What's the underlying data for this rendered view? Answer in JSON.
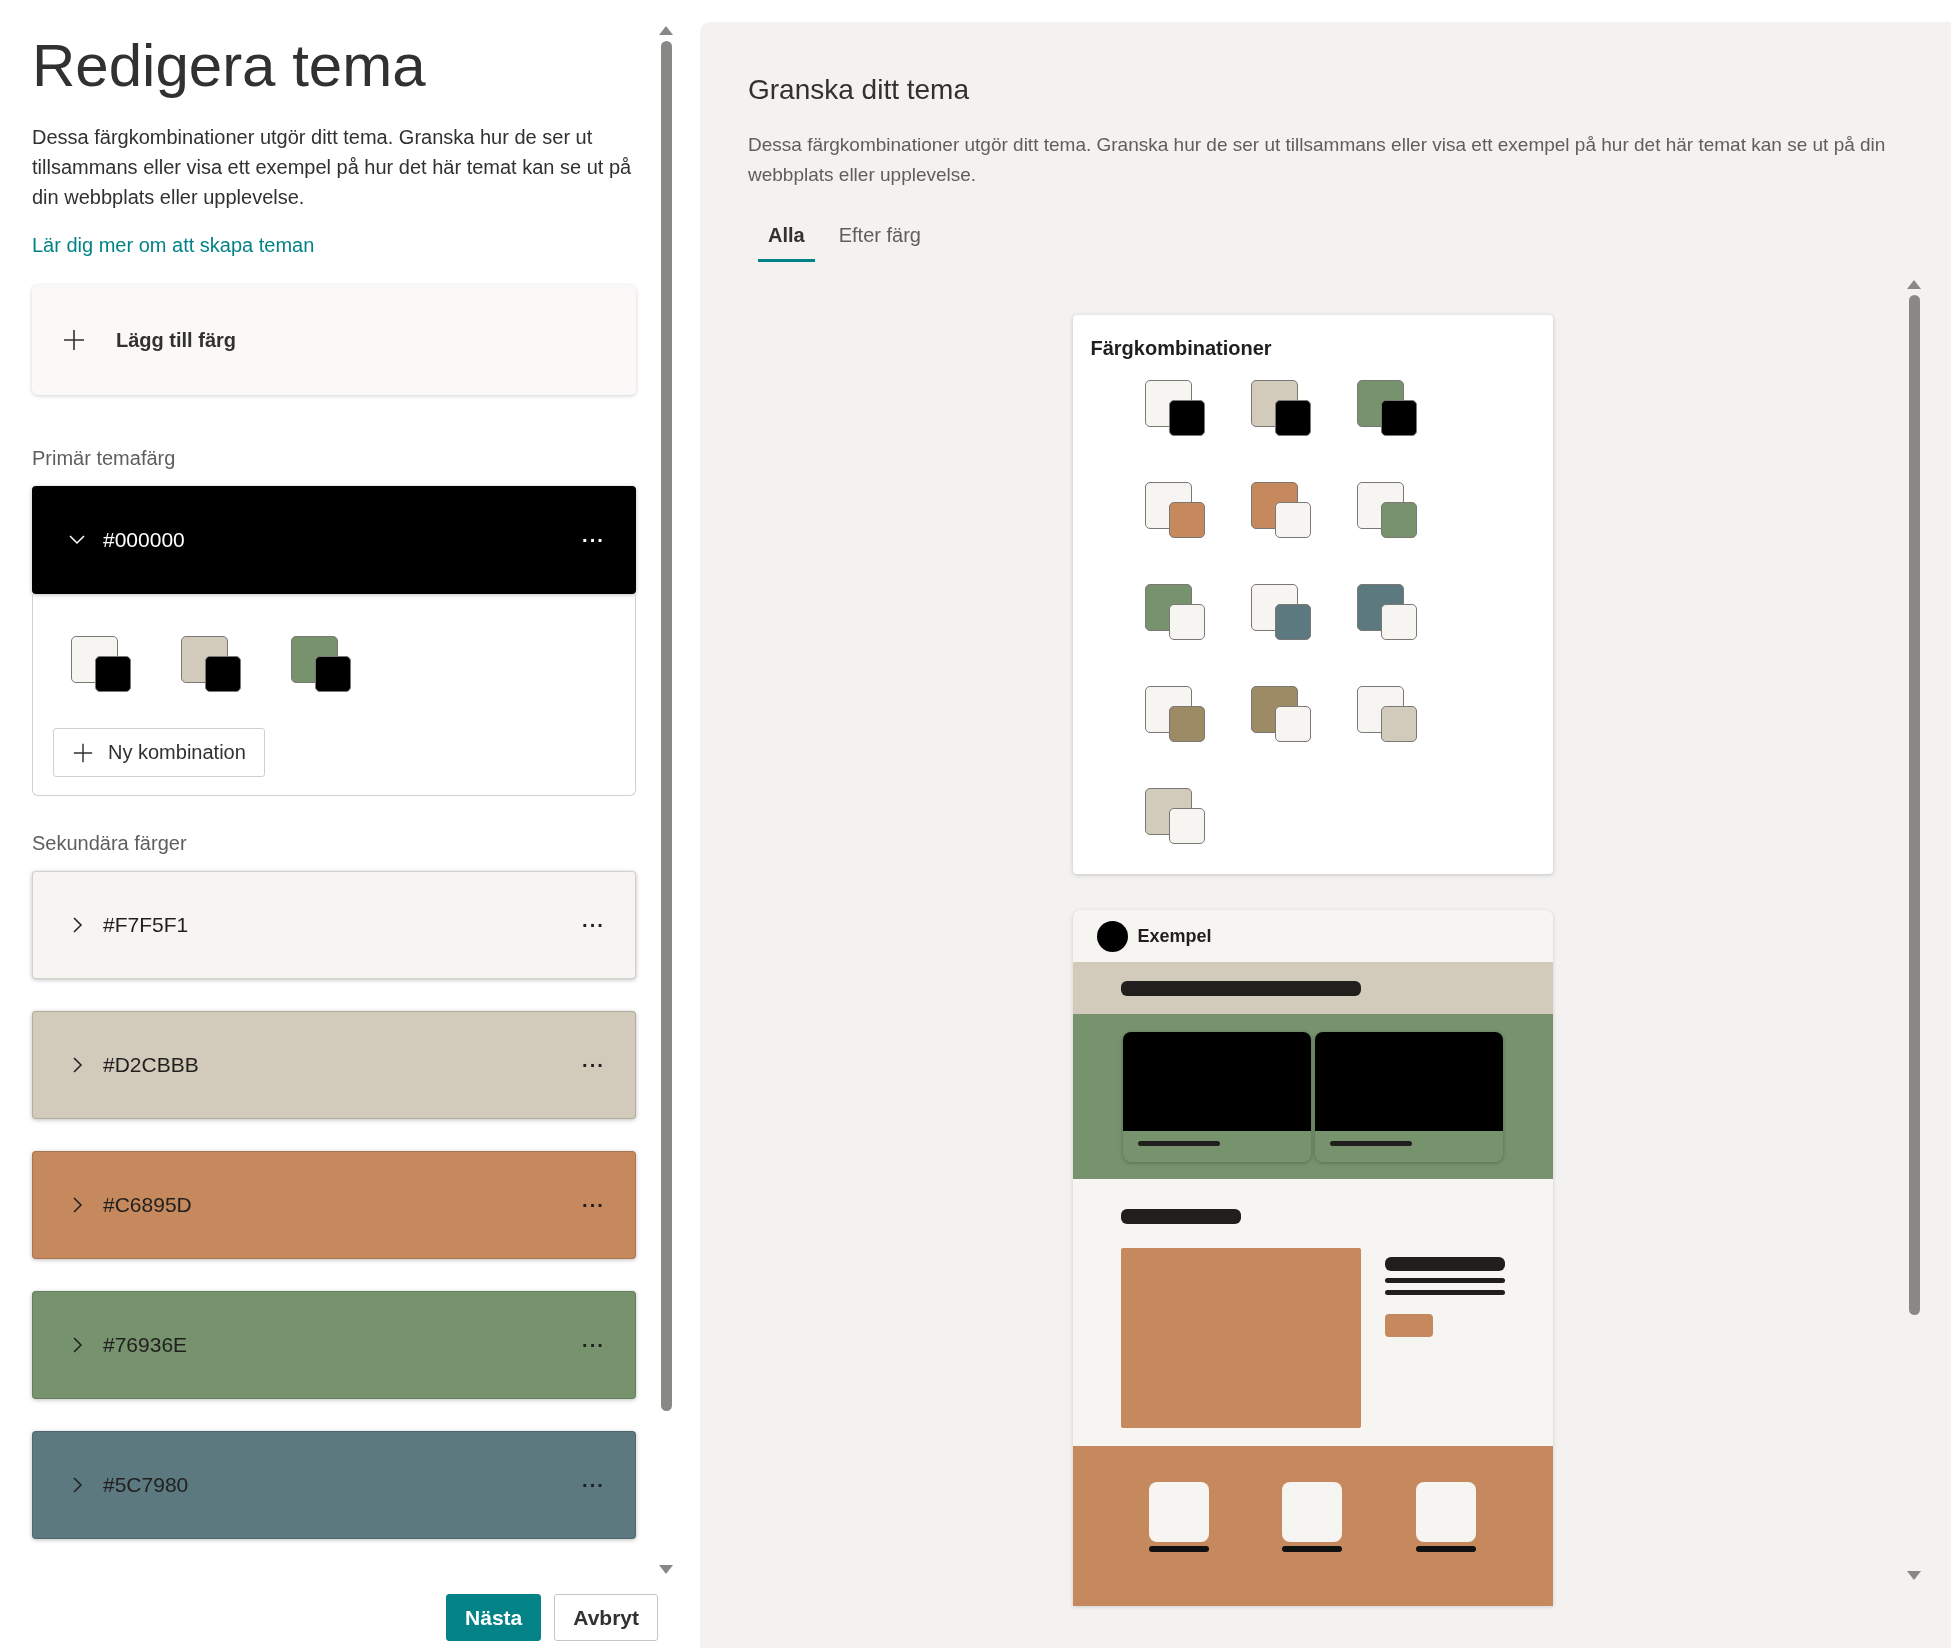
{
  "editor": {
    "title": "Redigera tema",
    "description": "Dessa färgkombinationer utgör ditt tema. Granska hur de ser ut tillsammans eller visa ett exempel på hur det här temat kan se ut på din webbplats eller upplevelse.",
    "link": "Lär dig mer om att skapa teman",
    "add_color_button": "Lägg till färg",
    "primary_label": "Primär temafärg",
    "primary_color": {
      "hex": "#000000",
      "color": "#000000",
      "expanded": true,
      "menu": "···",
      "combinations": [
        {
          "background": {
            "color": "#f7f5f1"
          },
          "foreground": {
            "color": "#000000"
          }
        },
        {
          "background": {
            "color": "#d2cbbb"
          },
          "foreground": {
            "color": "#000000"
          }
        },
        {
          "background": {
            "color": "#76936e"
          },
          "foreground": {
            "color": "#000000"
          }
        }
      ],
      "new_combination_button": "Ny kombination"
    },
    "secondary_label": "Sekundära färger",
    "secondary_colors": [
      {
        "hex": "#F7F5F1",
        "color": "#f7f5f1",
        "expanded": false,
        "menu": "···"
      },
      {
        "hex": "#D2CBBB",
        "color": "#d2cbbb",
        "expanded": false,
        "menu": "···"
      },
      {
        "hex": "#C6895D",
        "color": "#c6895d",
        "expanded": false,
        "menu": "···"
      },
      {
        "hex": "#76936E",
        "color": "#76936e",
        "expanded": false,
        "menu": "···"
      },
      {
        "hex": "#5C7980",
        "color": "#5c7980",
        "expanded": false,
        "menu": "···"
      }
    ],
    "buttons": [
      {
        "label": "Nästa",
        "kind": "primary"
      },
      {
        "label": "Avbryt",
        "kind": "secondary"
      }
    ]
  },
  "preview": {
    "title": "Granska ditt tema",
    "description": "Dessa färgkombinationer utgör ditt tema. Granska hur de ser ut tillsammans eller visa ett exempel på hur det här temat kan se ut på din webbplats eller upplevelse.",
    "tabs": [
      {
        "label": "Alla",
        "selected": true
      },
      {
        "label": "Efter färg",
        "selected": false
      }
    ],
    "combinations_card": {
      "title": "Färgkombinationer",
      "combinations": [
        {
          "background": {
            "color": "#f7f5f1"
          },
          "foreground": {
            "color": "#000000"
          }
        },
        {
          "background": {
            "color": "#d2cbbb"
          },
          "foreground": {
            "color": "#000000"
          }
        },
        {
          "background": {
            "color": "#76936e"
          },
          "foreground": {
            "color": "#000000"
          }
        },
        {
          "background": {
            "color": "#f7f5f1"
          },
          "foreground": {
            "color": "#c6895d"
          }
        },
        {
          "background": {
            "color": "#c6895d"
          },
          "foreground": {
            "color": "#f7f5f1"
          }
        },
        {
          "background": {
            "color": "#f7f5f1"
          },
          "foreground": {
            "color": "#76936e"
          }
        },
        {
          "background": {
            "color": "#76936e"
          },
          "foreground": {
            "color": "#f7f5f1"
          }
        },
        {
          "background": {
            "color": "#f7f5f1"
          },
          "foreground": {
            "color": "#5c7980"
          }
        },
        {
          "background": {
            "color": "#5c7980"
          },
          "foreground": {
            "color": "#f7f5f1"
          }
        },
        {
          "background": {
            "color": "#f7f5f1"
          },
          "foreground": {
            "color": "#9c8b65"
          }
        },
        {
          "background": {
            "color": "#9c8b65"
          },
          "foreground": {
            "color": "#f7f5f1"
          }
        },
        {
          "background": {
            "color": "#f7f5f1"
          },
          "foreground": {
            "color": "#d2cbbb"
          }
        },
        {
          "background": {
            "color": "#d2cbbb"
          },
          "foreground": {
            "color": "#f7f5f1"
          }
        }
      ]
    },
    "example_card": {
      "title": "Exempel"
    }
  }
}
